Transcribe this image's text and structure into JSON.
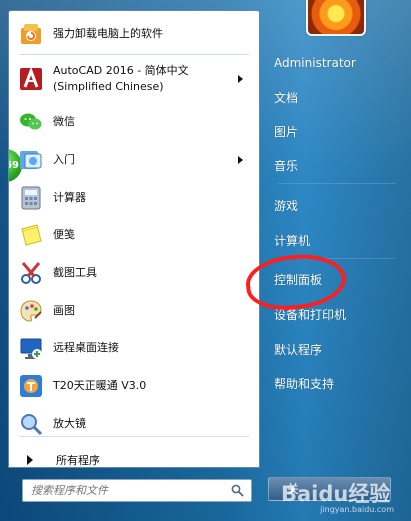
{
  "left_pane": {
    "items": [
      {
        "label": "强力卸载电脑上的软件",
        "icon": "uninstall-box-icon"
      },
      {
        "label_line1": "AutoCAD 2016 - 简体中文",
        "label_line2": "(Simplified Chinese)",
        "icon": "autocad-icon"
      },
      {
        "label": "微信",
        "icon": "wechat-icon"
      },
      {
        "label": "入门",
        "icon": "getting-started-icon"
      },
      {
        "label": "计算器",
        "icon": "calculator-icon"
      },
      {
        "label": "便笺",
        "icon": "sticky-notes-icon"
      },
      {
        "label": "截图工具",
        "icon": "snipping-tool-icon"
      },
      {
        "label": "画图",
        "icon": "paint-icon"
      },
      {
        "label": "远程桌面连接",
        "icon": "remote-desktop-icon"
      },
      {
        "label": "T20天正暖通 V3.0",
        "icon": "t20-icon"
      },
      {
        "label": "放大镜",
        "icon": "magnifier-icon"
      }
    ],
    "all_programs": "所有程序",
    "search_placeholder": "搜索程序和文件",
    "badge_number": "69"
  },
  "right_pane": {
    "items": [
      "Administrator",
      "文档",
      "图片",
      "音乐",
      "游戏",
      "计算机",
      "控制面板",
      "设备和打印机",
      "默认程序",
      "帮助和支持"
    ],
    "shutdown_label": "关"
  },
  "watermark": {
    "main": "Baidu经验",
    "sub": "jingyan.baidu.com"
  },
  "colors": {
    "annotation_red": "#ff1e1e",
    "menu_blue": "#1a6fa7",
    "white": "#ffffff"
  }
}
